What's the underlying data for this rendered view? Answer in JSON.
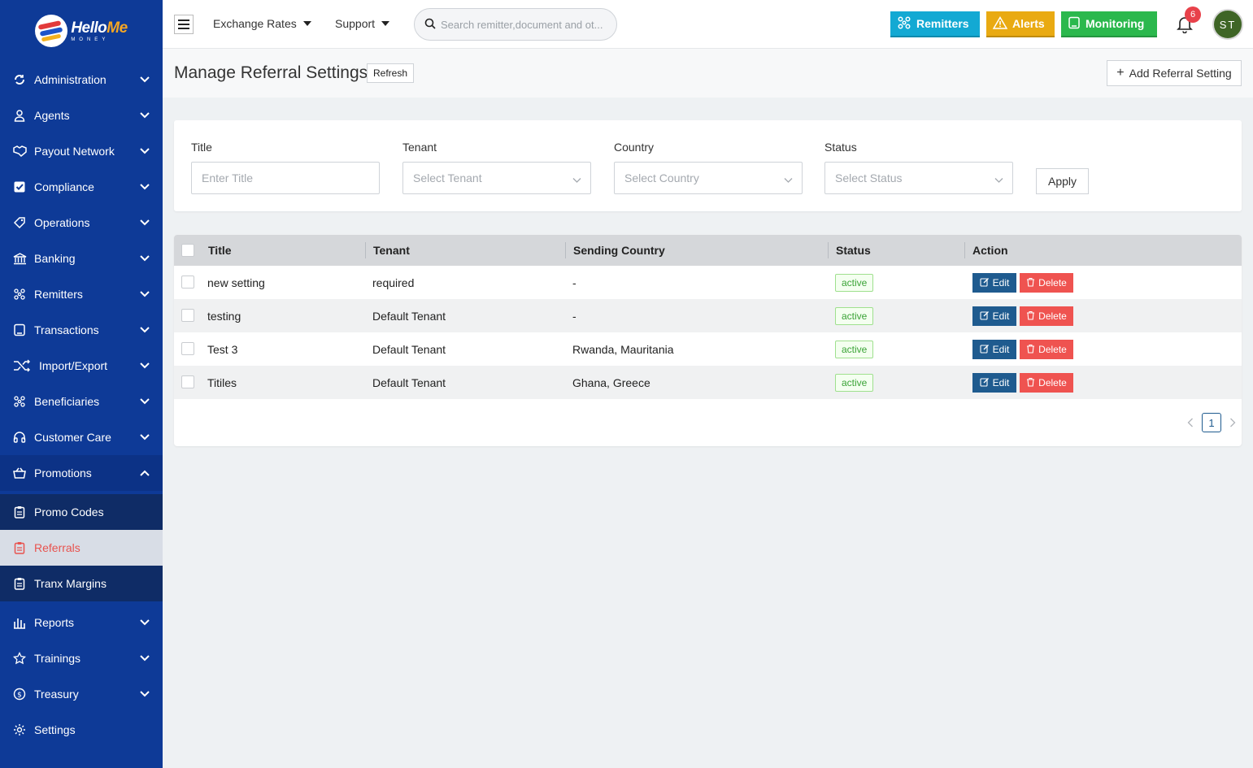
{
  "brand": {
    "name_a": "Hello",
    "name_b": "Me",
    "tagline": "MONEY"
  },
  "sidebar": {
    "items": [
      {
        "label": "Administration",
        "icon": "sync-icon"
      },
      {
        "label": "Agents",
        "icon": "user-icon"
      },
      {
        "label": "Payout Network",
        "icon": "handshake-icon"
      },
      {
        "label": "Compliance",
        "icon": "check-square-icon"
      },
      {
        "label": "Operations",
        "icon": "tag-icon"
      },
      {
        "label": "Banking",
        "icon": "bank-icon"
      },
      {
        "label": "Remitters",
        "icon": "network-icon"
      },
      {
        "label": "Transactions",
        "icon": "message-square-icon"
      },
      {
        "label": "Import/Export",
        "icon": "shuffle-icon"
      },
      {
        "label": "Beneficiaries",
        "icon": "network-icon"
      },
      {
        "label": "Customer Care",
        "icon": "headset-icon"
      },
      {
        "label": "Promotions",
        "icon": "basket-icon"
      }
    ],
    "promotions_sub": [
      {
        "label": "Promo Codes",
        "icon": "clipboard-icon"
      },
      {
        "label": "Referrals",
        "icon": "clipboard-icon"
      },
      {
        "label": "Tranx Margins",
        "icon": "clipboard-icon"
      }
    ],
    "items_after": [
      {
        "label": "Reports",
        "icon": "bar-chart-icon"
      },
      {
        "label": "Trainings",
        "icon": "star-icon"
      },
      {
        "label": "Treasury",
        "icon": "dollar-circle-icon"
      },
      {
        "label": "Settings",
        "icon": "gear-icon"
      }
    ]
  },
  "topbar": {
    "exchange_rates": "Exchange Rates",
    "support": "Support",
    "search_placeholder": "Search remitter,document and ot...",
    "remitters": "Remitters",
    "alerts": "Alerts",
    "monitoring": "Monitoring",
    "notification_count": "6",
    "avatar_initials": "ST",
    "colors": {
      "remitters": "#13a9d3",
      "alerts": "#e9aa12",
      "monitoring": "#2bb84d"
    }
  },
  "page": {
    "title": "Manage Referral Settings",
    "refresh": "Refresh",
    "add": "Add Referral Setting"
  },
  "filters": {
    "title_label": "Title",
    "title_placeholder": "Enter Title",
    "tenant_label": "Tenant",
    "tenant_placeholder": "Select Tenant",
    "country_label": "Country",
    "country_placeholder": "Select Country",
    "status_label": "Status",
    "status_placeholder": "Select Status",
    "apply": "Apply"
  },
  "table": {
    "columns": [
      "Title",
      "Tenant",
      "Sending Country",
      "Status",
      "Action"
    ],
    "rows": [
      {
        "title": "new setting",
        "tenant": "required",
        "country": "-",
        "status": "active"
      },
      {
        "title": "testing",
        "tenant": "Default Tenant",
        "country": "-",
        "status": "active"
      },
      {
        "title": "Test 3",
        "tenant": "Default Tenant",
        "country": "Rwanda, Mauritania",
        "status": "active"
      },
      {
        "title": "Titiles",
        "tenant": "Default Tenant",
        "country": "Ghana, Greece",
        "status": "active"
      }
    ],
    "edit": "Edit",
    "delete": "Delete"
  },
  "pagination": {
    "current": "1"
  }
}
